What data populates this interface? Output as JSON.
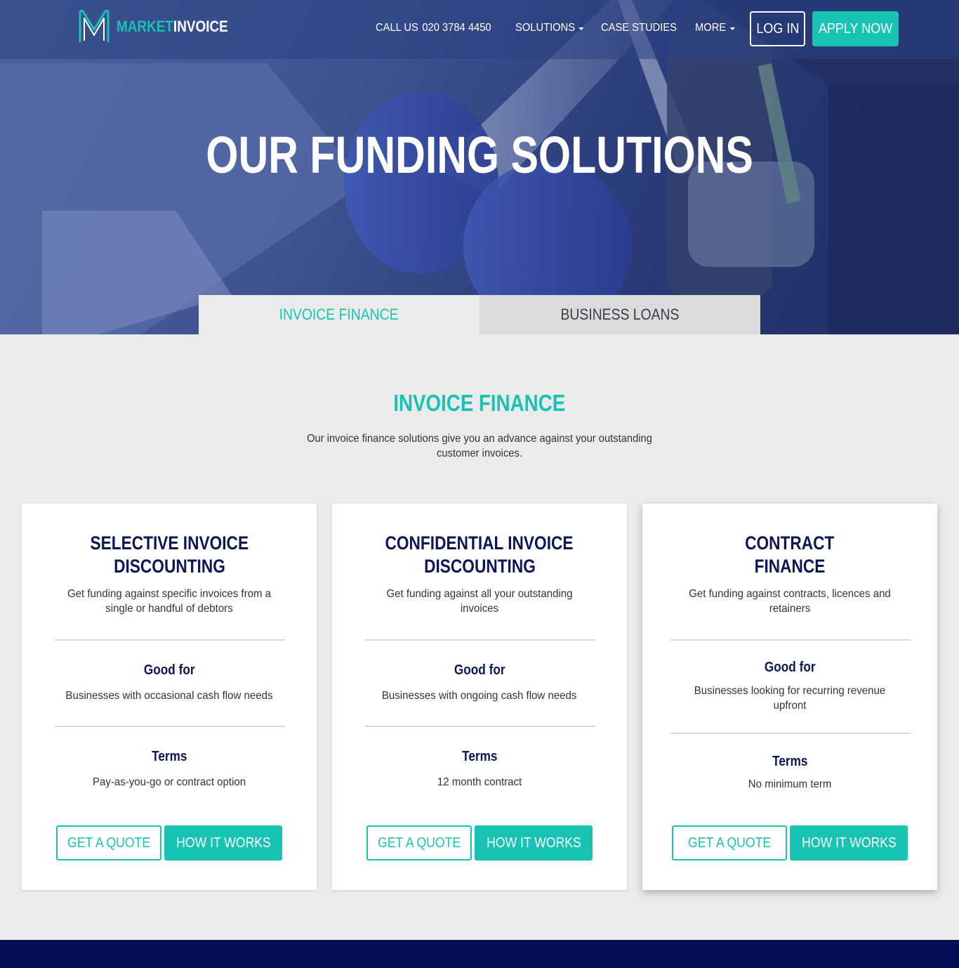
{
  "brand": {
    "name_part1": "MARKET",
    "name_part2": "INVOICE",
    "accent_color": "#19c3b4",
    "navy_color": "#0d1654"
  },
  "nav": {
    "call_label": "CALL US",
    "phone": "020 3784 4450",
    "solutions": "SOLUTIONS",
    "case_studies": "CASE STUDIES",
    "more": "MORE",
    "login": "LOG IN",
    "apply": "APPLY NOW"
  },
  "hero": {
    "title": "OUR FUNDING SOLUTIONS"
  },
  "tabs": [
    {
      "label": "INVOICE FINANCE",
      "active": true
    },
    {
      "label": "BUSINESS LOANS",
      "active": false
    }
  ],
  "section": {
    "title": "INVOICE FINANCE",
    "description": "Our invoice finance solutions give you an advance against your outstanding customer invoices."
  },
  "cards": [
    {
      "title_line1": "SELECTIVE INVOICE",
      "title_line2": "DISCOUNTING",
      "subtitle": "Get funding against specific invoices from a single or handful of debtors",
      "good_for_label": "Good for",
      "good_for": "Businesses with occasional cash flow needs",
      "terms_label": "Terms",
      "terms": "Pay-as-you-go or contract option",
      "quote_button": "GET A QUOTE",
      "how_button": "HOW IT WORKS"
    },
    {
      "title_line1": "CONFIDENTIAL INVOICE",
      "title_line2": "DISCOUNTING",
      "subtitle": "Get funding against all your outstanding invoices",
      "good_for_label": "Good for",
      "good_for": "Businesses with ongoing cash flow needs",
      "terms_label": "Terms",
      "terms": "12 month contract",
      "quote_button": "GET A QUOTE",
      "how_button": "HOW IT WORKS"
    },
    {
      "title_line1": "CONTRACT",
      "title_line2": "FINANCE",
      "subtitle": "Get funding against contracts, licences and retainers",
      "good_for_label": "Good for",
      "good_for": "Businesses looking for recurring revenue upfront",
      "terms_label": "Terms",
      "terms": "No minimum term",
      "quote_button": "GET A QUOTE",
      "how_button": "HOW IT WORKS"
    }
  ]
}
